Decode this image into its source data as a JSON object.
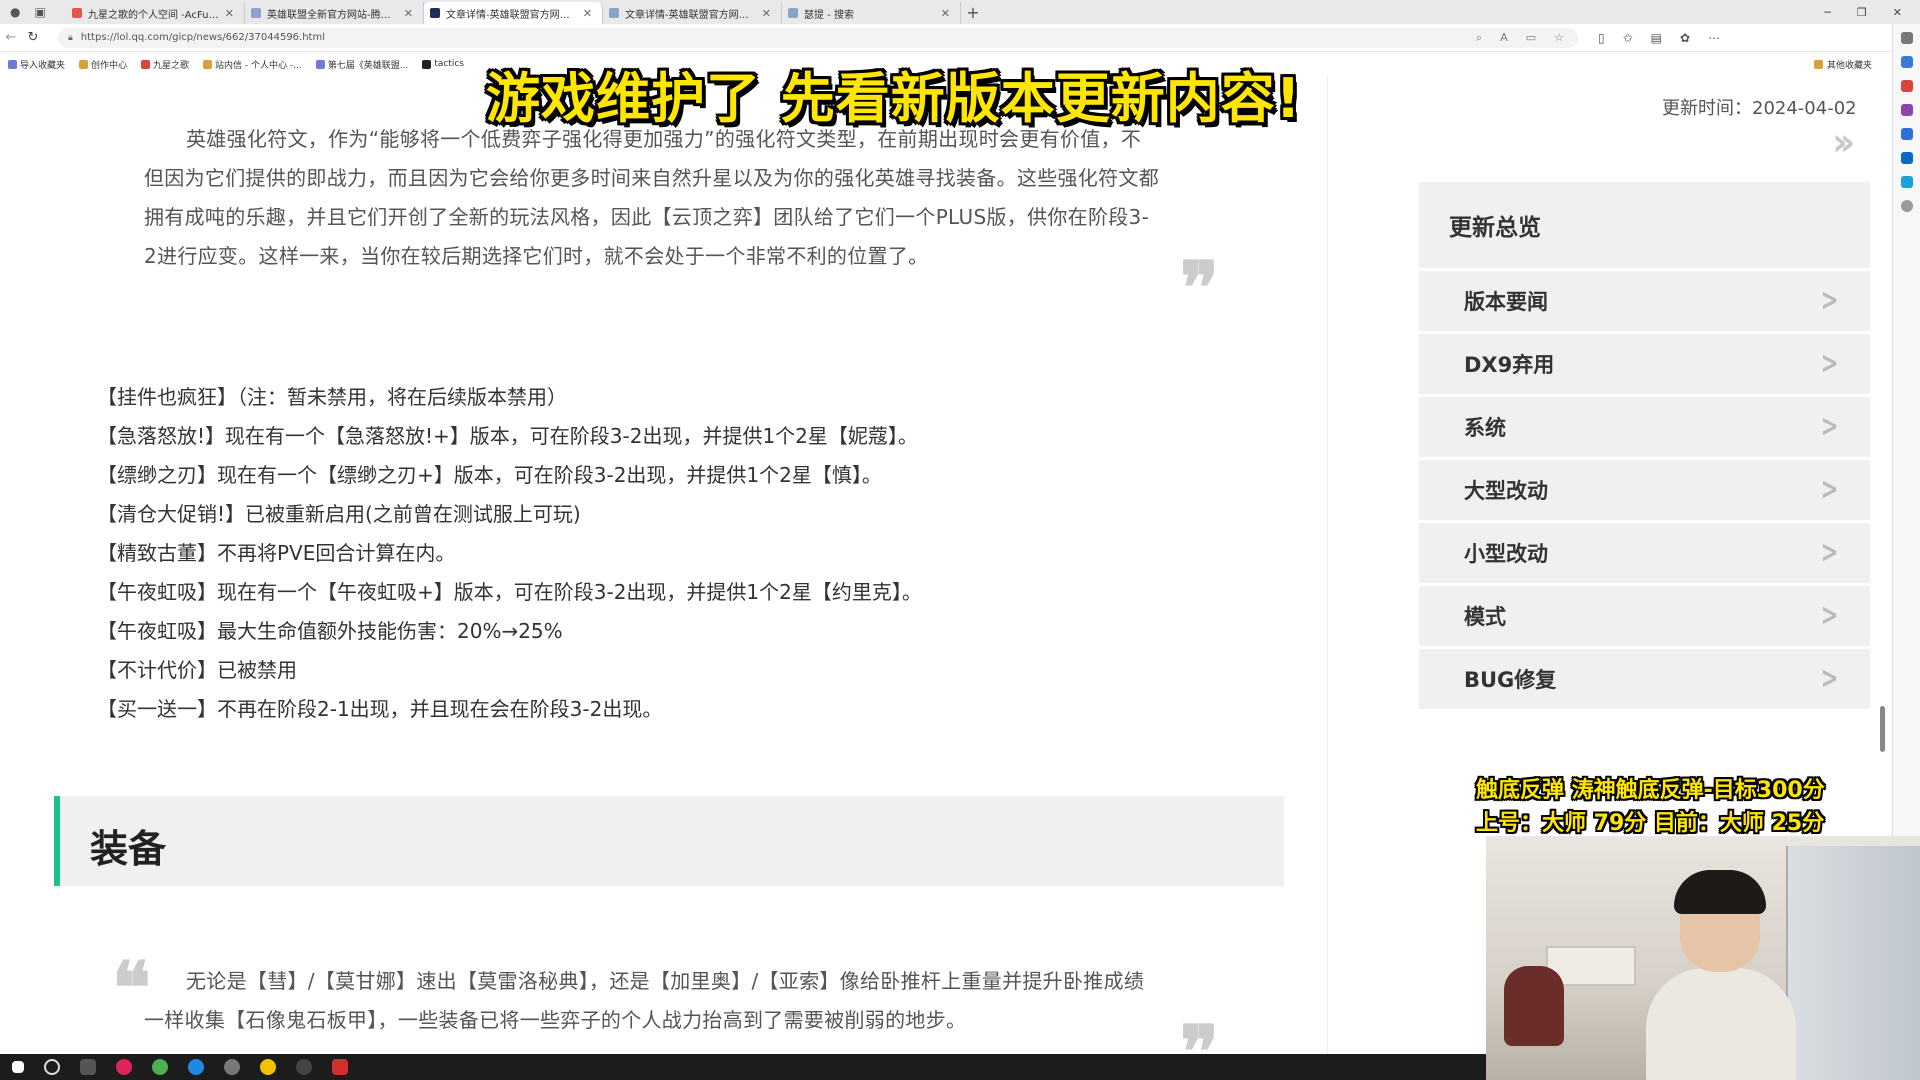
{
  "browser": {
    "tabs": [
      {
        "label": "九星之歌的个人空间 -AcFun弹幕",
        "fav": "red"
      },
      {
        "label": "英雄联盟全新官方网站-腾讯游戏",
        "fav": ""
      },
      {
        "label": "文章详情-英雄联盟官方网站-腾讯",
        "fav": "dark"
      },
      {
        "label": "文章详情-英雄联盟官方网站-腾讯",
        "fav": ""
      },
      {
        "label": "瑟提 - 搜索",
        "fav": ""
      }
    ],
    "url": "https://lol.qq.com/gicp/news/662/37044596.html",
    "favorites": [
      "导入收藏夹",
      "创作中心",
      "九星之歌",
      "站内信 - 个人中心 -...",
      "第七届《英雄联盟...",
      "tactics"
    ],
    "other_favorites": "其他收藏夹"
  },
  "article": {
    "intro_paragraph_lines": [
      "英雄强化符文，作为“能够将一个低费弈子强化得更加强力”的强化符文类型，在前期出现时会更有价值，不",
      "但因为它们提供的即战力，而且因为它会给你更多时间来自然升星以及为你的强化英雄寻找装备。这些强化符文都",
      "拥有成吨的乐趣，并且它们开创了全新的玩法风格，因此【云顶之弈】团队给了它们一个PLUS版，供你在阶段3-",
      "2进行应变。这样一来，当你在较后期选择它们时，就不会处于一个非常不利的位置了。"
    ],
    "augment_changes": [
      "【挂件也疯狂】（注：暂未禁用，将在后续版本禁用）",
      "【急落怒放!】现在有一个【急落怒放!+】版本，可在阶段3-2出现，并提供1个2星【妮蔻】。",
      "【缥缈之刃】现在有一个【缥缈之刃+】版本，可在阶段3-2出现，并提供1个2星【慎】。",
      "【清仓大促销!】已被重新启用(之前曾在测试服上可玩)",
      "【精致古董】不再将PVE回合计算在内。",
      "【午夜虹吸】现在有一个【午夜虹吸+】版本，可在阶段3-2出现，并提供1个2星【约里克】。",
      "【午夜虹吸】最大生命值额外技能伤害：20%→25%",
      "【不计代价】已被禁用",
      "【买一送一】不再在阶段2-1出现，并且现在会在阶段3-2出现。"
    ],
    "section_title": "装备",
    "equipment_paragraph_lines": [
      "无论是【彗】/【莫甘娜】速出【莫雷洛秘典】，还是【加里奥】/【亚索】像给卧推杆上重量并提升卧推成绩",
      "一样收集【石像鬼石板甲】，一些装备已将一些弈子的个人战力抬高到了需要被削弱的地步。"
    ],
    "accent_color": "#1fbf8f"
  },
  "sidebar": {
    "update_time": "更新时间：2024-04-02",
    "toc_title": "更新总览",
    "toc_items": [
      "版本要闻",
      "DX9弃用",
      "系统",
      "大型改动",
      "小型改动",
      "模式",
      "BUG修复"
    ]
  },
  "overlay": {
    "title": "游戏维护了 先看新版本更新内容!",
    "status_line1": "触底反弹 涛神触底反弹-目标300分",
    "status_line2": "上号：大师 79分 目前：大师 25分"
  }
}
